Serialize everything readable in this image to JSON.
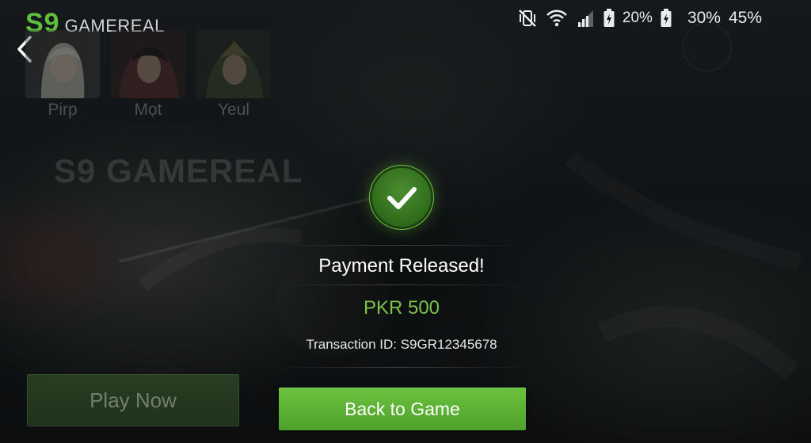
{
  "brand": {
    "mark": "S9",
    "name": "GAMEREAL"
  },
  "status_bar": {
    "battery_1": "20%",
    "battery_2": "30%",
    "extra": "45%",
    "icons": [
      "vibrate-off-icon",
      "wifi-icon",
      "signal-icon",
      "battery-charging-icon",
      "battery-icon"
    ]
  },
  "characters": [
    {
      "name": "Pirp"
    },
    {
      "name": "Mọt"
    },
    {
      "name": "Yeul"
    }
  ],
  "background_logo": "S9 GAMEREAL",
  "dialog": {
    "title": "Payment Released!",
    "amount": "PKR 500",
    "transaction": "Transaction ID: S9GR12345678"
  },
  "buttons": {
    "play_now": "Play Now",
    "back_to_game": "Back to Game"
  },
  "colors": {
    "accent_green": "#6cc23f",
    "amount_green": "#7cc24a",
    "brand_green": "#5fbf3a"
  }
}
